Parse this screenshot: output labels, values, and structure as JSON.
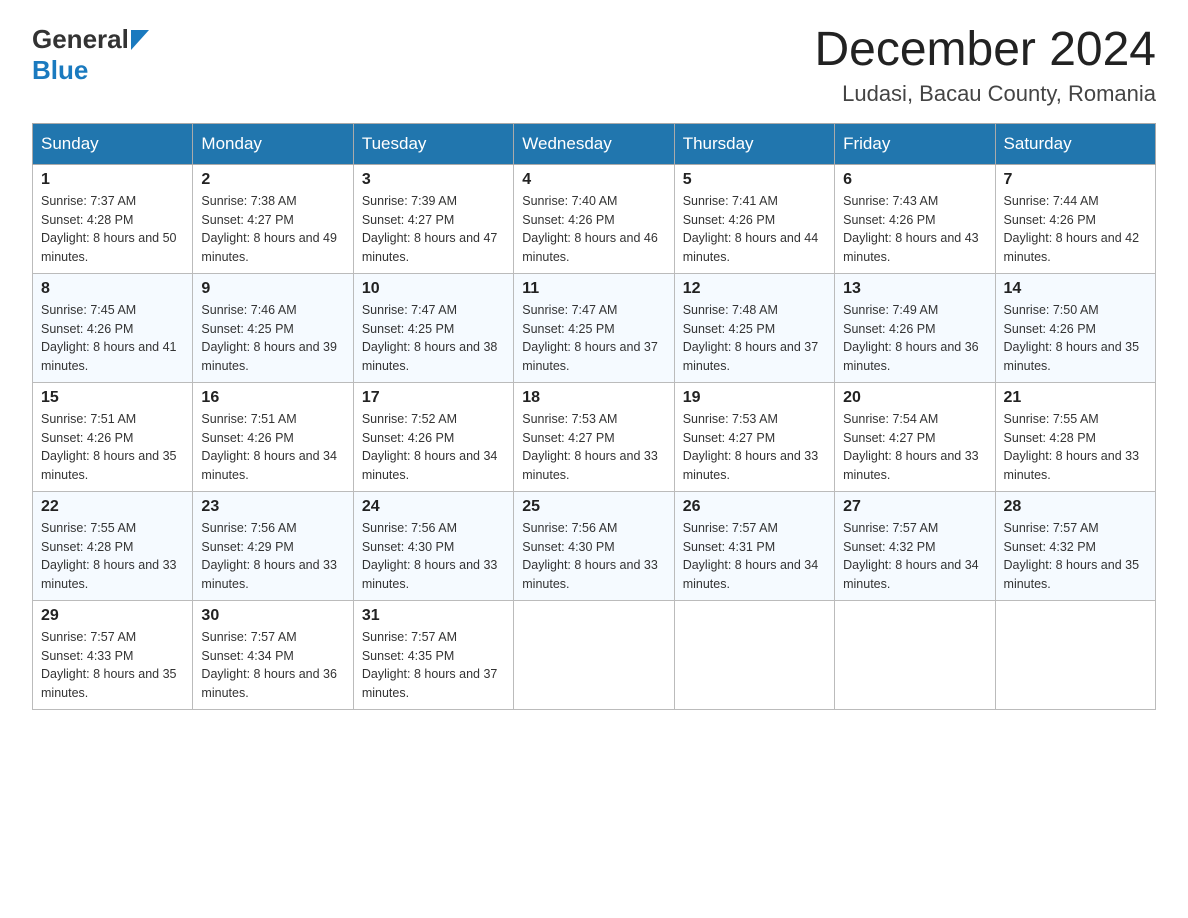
{
  "header": {
    "logo_general": "General",
    "logo_blue": "Blue",
    "title": "December 2024",
    "subtitle": "Ludasi, Bacau County, Romania"
  },
  "calendar": {
    "days_of_week": [
      "Sunday",
      "Monday",
      "Tuesday",
      "Wednesday",
      "Thursday",
      "Friday",
      "Saturday"
    ],
    "weeks": [
      [
        {
          "day": "1",
          "sunrise": "7:37 AM",
          "sunset": "4:28 PM",
          "daylight": "8 hours and 50 minutes."
        },
        {
          "day": "2",
          "sunrise": "7:38 AM",
          "sunset": "4:27 PM",
          "daylight": "8 hours and 49 minutes."
        },
        {
          "day": "3",
          "sunrise": "7:39 AM",
          "sunset": "4:27 PM",
          "daylight": "8 hours and 47 minutes."
        },
        {
          "day": "4",
          "sunrise": "7:40 AM",
          "sunset": "4:26 PM",
          "daylight": "8 hours and 46 minutes."
        },
        {
          "day": "5",
          "sunrise": "7:41 AM",
          "sunset": "4:26 PM",
          "daylight": "8 hours and 44 minutes."
        },
        {
          "day": "6",
          "sunrise": "7:43 AM",
          "sunset": "4:26 PM",
          "daylight": "8 hours and 43 minutes."
        },
        {
          "day": "7",
          "sunrise": "7:44 AM",
          "sunset": "4:26 PM",
          "daylight": "8 hours and 42 minutes."
        }
      ],
      [
        {
          "day": "8",
          "sunrise": "7:45 AM",
          "sunset": "4:26 PM",
          "daylight": "8 hours and 41 minutes."
        },
        {
          "day": "9",
          "sunrise": "7:46 AM",
          "sunset": "4:25 PM",
          "daylight": "8 hours and 39 minutes."
        },
        {
          "day": "10",
          "sunrise": "7:47 AM",
          "sunset": "4:25 PM",
          "daylight": "8 hours and 38 minutes."
        },
        {
          "day": "11",
          "sunrise": "7:47 AM",
          "sunset": "4:25 PM",
          "daylight": "8 hours and 37 minutes."
        },
        {
          "day": "12",
          "sunrise": "7:48 AM",
          "sunset": "4:25 PM",
          "daylight": "8 hours and 37 minutes."
        },
        {
          "day": "13",
          "sunrise": "7:49 AM",
          "sunset": "4:26 PM",
          "daylight": "8 hours and 36 minutes."
        },
        {
          "day": "14",
          "sunrise": "7:50 AM",
          "sunset": "4:26 PM",
          "daylight": "8 hours and 35 minutes."
        }
      ],
      [
        {
          "day": "15",
          "sunrise": "7:51 AM",
          "sunset": "4:26 PM",
          "daylight": "8 hours and 35 minutes."
        },
        {
          "day": "16",
          "sunrise": "7:51 AM",
          "sunset": "4:26 PM",
          "daylight": "8 hours and 34 minutes."
        },
        {
          "day": "17",
          "sunrise": "7:52 AM",
          "sunset": "4:26 PM",
          "daylight": "8 hours and 34 minutes."
        },
        {
          "day": "18",
          "sunrise": "7:53 AM",
          "sunset": "4:27 PM",
          "daylight": "8 hours and 33 minutes."
        },
        {
          "day": "19",
          "sunrise": "7:53 AM",
          "sunset": "4:27 PM",
          "daylight": "8 hours and 33 minutes."
        },
        {
          "day": "20",
          "sunrise": "7:54 AM",
          "sunset": "4:27 PM",
          "daylight": "8 hours and 33 minutes."
        },
        {
          "day": "21",
          "sunrise": "7:55 AM",
          "sunset": "4:28 PM",
          "daylight": "8 hours and 33 minutes."
        }
      ],
      [
        {
          "day": "22",
          "sunrise": "7:55 AM",
          "sunset": "4:28 PM",
          "daylight": "8 hours and 33 minutes."
        },
        {
          "day": "23",
          "sunrise": "7:56 AM",
          "sunset": "4:29 PM",
          "daylight": "8 hours and 33 minutes."
        },
        {
          "day": "24",
          "sunrise": "7:56 AM",
          "sunset": "4:30 PM",
          "daylight": "8 hours and 33 minutes."
        },
        {
          "day": "25",
          "sunrise": "7:56 AM",
          "sunset": "4:30 PM",
          "daylight": "8 hours and 33 minutes."
        },
        {
          "day": "26",
          "sunrise": "7:57 AM",
          "sunset": "4:31 PM",
          "daylight": "8 hours and 34 minutes."
        },
        {
          "day": "27",
          "sunrise": "7:57 AM",
          "sunset": "4:32 PM",
          "daylight": "8 hours and 34 minutes."
        },
        {
          "day": "28",
          "sunrise": "7:57 AM",
          "sunset": "4:32 PM",
          "daylight": "8 hours and 35 minutes."
        }
      ],
      [
        {
          "day": "29",
          "sunrise": "7:57 AM",
          "sunset": "4:33 PM",
          "daylight": "8 hours and 35 minutes."
        },
        {
          "day": "30",
          "sunrise": "7:57 AM",
          "sunset": "4:34 PM",
          "daylight": "8 hours and 36 minutes."
        },
        {
          "day": "31",
          "sunrise": "7:57 AM",
          "sunset": "4:35 PM",
          "daylight": "8 hours and 37 minutes."
        },
        null,
        null,
        null,
        null
      ]
    ]
  }
}
